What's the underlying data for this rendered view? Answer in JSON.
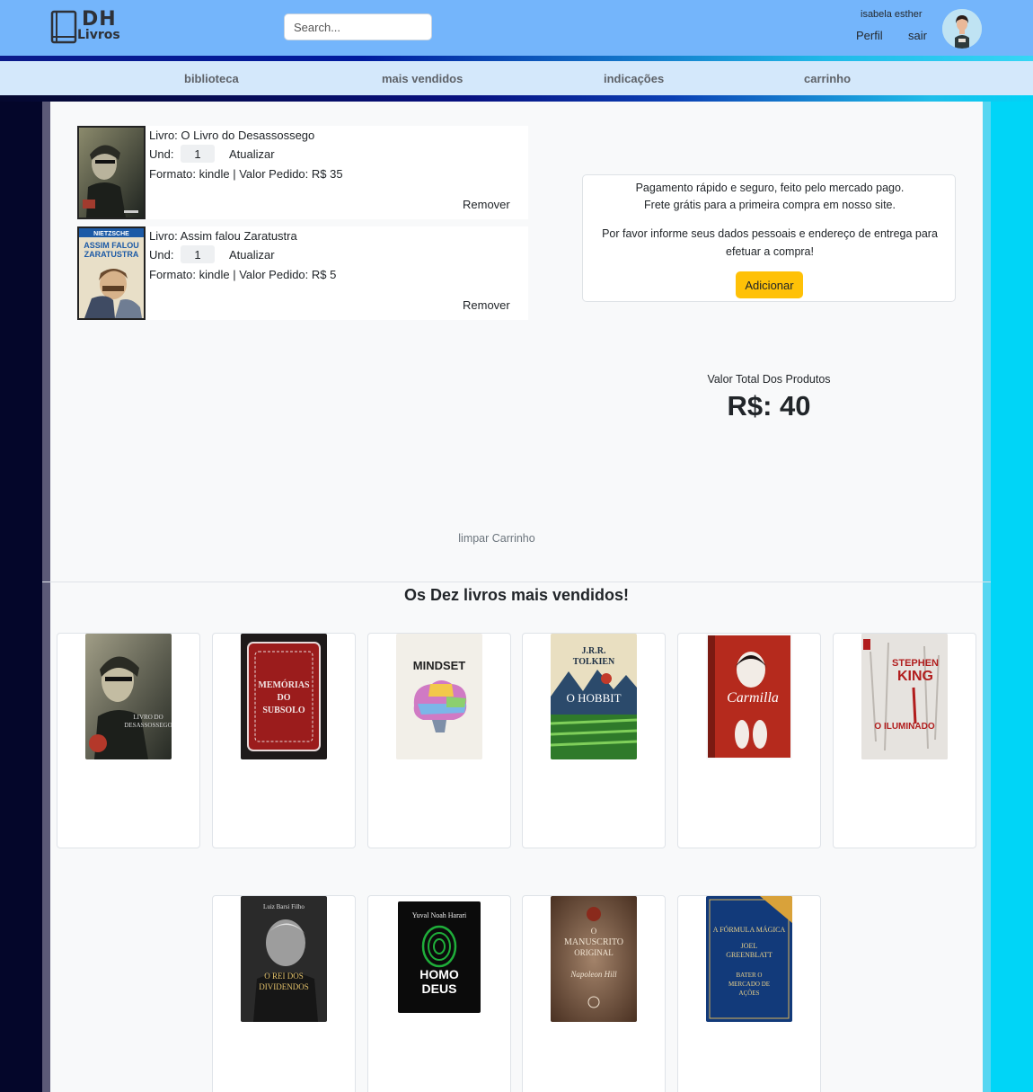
{
  "header": {
    "logo_dh": "DH",
    "logo_livros": "Livros",
    "search_placeholder": "Search...",
    "username": "isabela esther",
    "perfil": "Perfil",
    "sair": "sair",
    "bg_color": "#74b5fb"
  },
  "nav": {
    "items": [
      {
        "label": "biblioteca"
      },
      {
        "label": "mais vendidos"
      },
      {
        "label": "indicações"
      },
      {
        "label": "carrinho"
      }
    ]
  },
  "cart": {
    "items": [
      {
        "title": "Livro: O Livro do Desassossego",
        "und_label": "Und:",
        "quantity": "1",
        "update_label": "Atualizar",
        "format": "Formato: kindle | Valor Pedido: R$ 35",
        "remove_label": "Remover",
        "cover_icon": "livro-do-desassossego-cover"
      },
      {
        "title": "Livro: Assim falou Zaratustra",
        "und_label": "Und:",
        "quantity": "1",
        "update_label": "Atualizar",
        "format": "Formato: kindle | Valor Pedido: R$ 5",
        "remove_label": "Remover",
        "cover_icon": "assim-falou-zaratustra-cover",
        "cover_text_author": "NIETZSCHE",
        "cover_text_title": "ASSIM FALOU ZARATUSTRA"
      }
    ],
    "payment": {
      "line1": "Pagamento rápido e seguro, feito pelo mercado pago.",
      "line2": "Frete grátis para a primeira compra em nosso site.",
      "line3": "Por favor informe seus dados pessoais e endereço de entrega para",
      "line4": "efetuar a compra!",
      "button": "Adicionar",
      "button_color": "#ffc107"
    },
    "total_label": "Valor Total Dos Produtos",
    "total_value": "R$: 40",
    "clear_label": "limpar Carrinho"
  },
  "bestsellers": {
    "title": "Os Dez livros mais vendidos!",
    "books": [
      {
        "cover": "livro-do-desassossego-cover"
      },
      {
        "cover": "memorias-do-subsolo-cover",
        "cover_title": "MEMÓRIAS DO SUBSOLO"
      },
      {
        "cover": "mindset-cover",
        "cover_title": "MINDSET"
      },
      {
        "cover": "o-hobbit-cover",
        "cover_author": "J.R.R. TOLKIEN",
        "cover_title": "O HOBBIT"
      },
      {
        "cover": "carmilla-cover",
        "cover_title": "Carmilla"
      },
      {
        "cover": "o-iluminado-cover",
        "cover_author": "STEPHEN KING",
        "cover_title": "O ILUMINADO"
      },
      {
        "cover": "o-rei-dos-dividendos-cover",
        "cover_title": "O REI DOS DIVIDENDOS"
      },
      {
        "cover": "homo-deus-cover",
        "cover_author": "Yuval Noah Harari",
        "cover_title": "HOMO DEUS"
      },
      {
        "cover": "o-manuscrito-original-cover",
        "cover_title": "O MANUSCRITO ORIGINAL"
      },
      {
        "cover": "a-formula-magica-cover",
        "cover_title": "A FÓRMULA MÁGICA"
      }
    ]
  }
}
